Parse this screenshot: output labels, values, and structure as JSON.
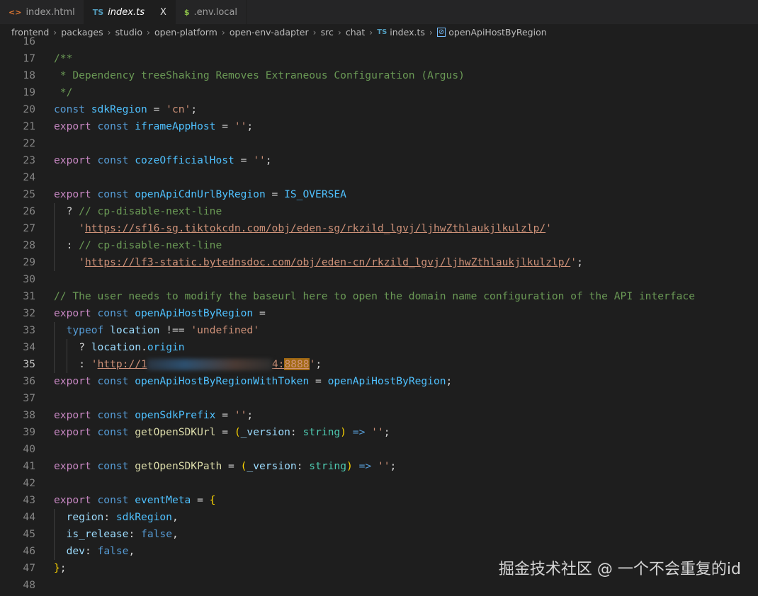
{
  "tabs": [
    {
      "icon": "<>",
      "label": "index.html",
      "icon_color": "#e37933"
    },
    {
      "icon": "TS",
      "label": "index.ts",
      "icon_color": "#519aba",
      "active": true,
      "close": "X"
    },
    {
      "icon": "$",
      "label": ".env.local",
      "icon_color": "#8dc149"
    }
  ],
  "breadcrumb": [
    "frontend",
    "packages",
    "studio",
    "open-platform",
    "open-env-adapter",
    "src",
    "chat",
    "index.ts",
    "openApiHostByRegion"
  ],
  "breadcrumb_file_icon": "TS",
  "current_line": 35,
  "lines": [
    {
      "n": 16,
      "t": []
    },
    {
      "n": 17,
      "t": [
        [
          "/**",
          "com"
        ]
      ]
    },
    {
      "n": 18,
      "t": [
        [
          " * Dependency treeShaking Removes Extraneous Configuration (Argus)",
          "com"
        ]
      ]
    },
    {
      "n": 19,
      "t": [
        [
          " */",
          "com"
        ]
      ]
    },
    {
      "n": 20,
      "t": [
        [
          "const ",
          "kw"
        ],
        [
          "sdkRegion",
          "var"
        ],
        [
          " = ",
          "op"
        ],
        [
          "'cn'",
          "str"
        ],
        [
          ";",
          "op"
        ]
      ]
    },
    {
      "n": 21,
      "t": [
        [
          "export ",
          "ex"
        ],
        [
          "const ",
          "kw"
        ],
        [
          "iframeAppHost",
          "var"
        ],
        [
          " = ",
          "op"
        ],
        [
          "''",
          "str"
        ],
        [
          ";",
          "op"
        ]
      ]
    },
    {
      "n": 22,
      "t": []
    },
    {
      "n": 23,
      "t": [
        [
          "export ",
          "ex"
        ],
        [
          "const ",
          "kw"
        ],
        [
          "cozeOfficialHost",
          "var"
        ],
        [
          " = ",
          "op"
        ],
        [
          "''",
          "str"
        ],
        [
          ";",
          "op"
        ]
      ]
    },
    {
      "n": 24,
      "t": []
    },
    {
      "n": 25,
      "t": [
        [
          "export ",
          "ex"
        ],
        [
          "const ",
          "kw"
        ],
        [
          "openApiCdnUrlByRegion",
          "var"
        ],
        [
          " = ",
          "op"
        ],
        [
          "IS_OVERSEA",
          "var"
        ]
      ]
    },
    {
      "n": 26,
      "t": [
        [
          "",
          "indent"
        ],
        [
          "? ",
          "op"
        ],
        [
          "// cp-disable-next-line",
          "com"
        ]
      ]
    },
    {
      "n": 27,
      "t": [
        [
          "",
          "indent"
        ],
        [
          "  ",
          ""
        ],
        [
          "'",
          "str"
        ],
        [
          "https://sf16-sg.tiktokcdn.com/obj/eden-sg/rkzild_lgvj/ljhwZthlaukjlkulzlp/",
          "str link"
        ],
        [
          "'",
          "str"
        ]
      ]
    },
    {
      "n": 28,
      "t": [
        [
          "",
          "indent"
        ],
        [
          ": ",
          "op"
        ],
        [
          "// cp-disable-next-line",
          "com"
        ]
      ]
    },
    {
      "n": 29,
      "t": [
        [
          "",
          "indent"
        ],
        [
          "  ",
          ""
        ],
        [
          "'",
          "str"
        ],
        [
          "https://lf3-static.bytednsdoc.com/obj/eden-cn/rkzild_lgvj/ljhwZthlaukjlkulzlp/",
          "str link"
        ],
        [
          "'",
          "str"
        ],
        [
          ";",
          "op"
        ]
      ]
    },
    {
      "n": 30,
      "t": []
    },
    {
      "n": 31,
      "t": [
        [
          "// The user needs to modify the baseurl here to open the domain name configuration of the API interface",
          "com"
        ]
      ]
    },
    {
      "n": 32,
      "t": [
        [
          "export ",
          "ex"
        ],
        [
          "const ",
          "kw"
        ],
        [
          "openApiHostByRegion",
          "var"
        ],
        [
          " =",
          "op"
        ]
      ]
    },
    {
      "n": 33,
      "t": [
        [
          "",
          "indent"
        ],
        [
          "typeof ",
          "kw"
        ],
        [
          "location",
          "prop"
        ],
        [
          " !== ",
          "op"
        ],
        [
          "'undefined'",
          "str"
        ]
      ]
    },
    {
      "n": 34,
      "t": [
        [
          "",
          "indent"
        ],
        [
          "",
          "indent"
        ],
        [
          "? ",
          "op"
        ],
        [
          "location",
          "prop"
        ],
        [
          ".",
          "op"
        ],
        [
          "origin",
          "var"
        ]
      ]
    },
    {
      "n": 35,
      "t": [
        [
          "",
          "indent"
        ],
        [
          "",
          "indent"
        ],
        [
          ": ",
          "op"
        ],
        [
          "'",
          "str"
        ],
        [
          "http://1",
          "str link"
        ],
        [
          "",
          "blur"
        ],
        [
          "4:",
          "str link"
        ],
        [
          "8888",
          "str link hl"
        ],
        [
          "'",
          "str"
        ],
        [
          ";",
          "op"
        ]
      ]
    },
    {
      "n": 36,
      "t": [
        [
          "export ",
          "ex"
        ],
        [
          "const ",
          "kw"
        ],
        [
          "openApiHostByRegionWithToken",
          "var"
        ],
        [
          " = ",
          "op"
        ],
        [
          "openApiHostByRegion",
          "var"
        ],
        [
          ";",
          "op"
        ]
      ]
    },
    {
      "n": 37,
      "t": []
    },
    {
      "n": 38,
      "t": [
        [
          "export ",
          "ex"
        ],
        [
          "const ",
          "kw"
        ],
        [
          "openSdkPrefix",
          "var"
        ],
        [
          " = ",
          "op"
        ],
        [
          "''",
          "str"
        ],
        [
          ";",
          "op"
        ]
      ]
    },
    {
      "n": 39,
      "t": [
        [
          "export ",
          "ex"
        ],
        [
          "const ",
          "kw"
        ],
        [
          "getOpenSDKUrl",
          "fn"
        ],
        [
          " = ",
          "op"
        ],
        [
          "(",
          "par"
        ],
        [
          "_version",
          "prop"
        ],
        [
          ": ",
          "op"
        ],
        [
          "string",
          "ty"
        ],
        [
          ")",
          "par"
        ],
        [
          " => ",
          "kw"
        ],
        [
          "''",
          "str"
        ],
        [
          ";",
          "op"
        ]
      ]
    },
    {
      "n": 40,
      "t": []
    },
    {
      "n": 41,
      "t": [
        [
          "export ",
          "ex"
        ],
        [
          "const ",
          "kw"
        ],
        [
          "getOpenSDKPath",
          "fn"
        ],
        [
          " = ",
          "op"
        ],
        [
          "(",
          "par"
        ],
        [
          "_version",
          "prop"
        ],
        [
          ": ",
          "op"
        ],
        [
          "string",
          "ty"
        ],
        [
          ")",
          "par"
        ],
        [
          " => ",
          "kw"
        ],
        [
          "''",
          "str"
        ],
        [
          ";",
          "op"
        ]
      ]
    },
    {
      "n": 42,
      "t": []
    },
    {
      "n": 43,
      "t": [
        [
          "export ",
          "ex"
        ],
        [
          "const ",
          "kw"
        ],
        [
          "eventMeta",
          "var"
        ],
        [
          " = ",
          "op"
        ],
        [
          "{",
          "par"
        ]
      ]
    },
    {
      "n": 44,
      "t": [
        [
          "",
          "indent"
        ],
        [
          "region",
          "prop"
        ],
        [
          ": ",
          "op"
        ],
        [
          "sdkRegion",
          "var"
        ],
        [
          ",",
          "op"
        ]
      ]
    },
    {
      "n": 45,
      "t": [
        [
          "",
          "indent"
        ],
        [
          "is_release",
          "prop"
        ],
        [
          ": ",
          "op"
        ],
        [
          "false",
          "kw"
        ],
        [
          ",",
          "op"
        ]
      ]
    },
    {
      "n": 46,
      "t": [
        [
          "",
          "indent"
        ],
        [
          "dev",
          "prop"
        ],
        [
          ": ",
          "op"
        ],
        [
          "false",
          "kw"
        ],
        [
          ",",
          "op"
        ]
      ]
    },
    {
      "n": 47,
      "t": [
        [
          "}",
          "par"
        ],
        [
          ";",
          "op"
        ]
      ]
    },
    {
      "n": 48,
      "t": []
    }
  ],
  "watermark": "掘金技术社区 @ 一个不会重复的id"
}
